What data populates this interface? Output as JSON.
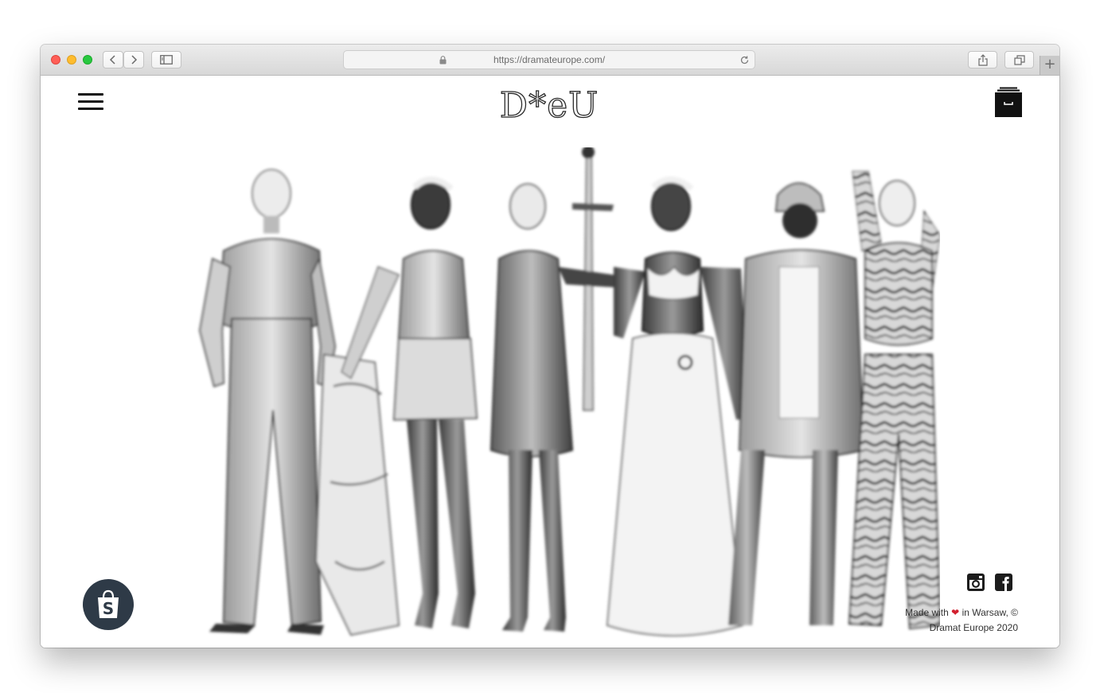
{
  "browser": {
    "url": "https://dramateurope.com/",
    "new_tab_label": "+"
  },
  "header": {
    "logo_text": "D*eU",
    "menu_icon": "hamburger-menu-icon",
    "cart_icon": "shopping-bag-icon"
  },
  "hero": {
    "image": "six-models-fashion-lineup-monochrome"
  },
  "social": {
    "instagram_icon": "instagram-icon",
    "facebook_icon": "facebook-icon"
  },
  "footer": {
    "made_with": "Made with",
    "heart": "❤",
    "in_warsaw": "in Warsaw, ©",
    "copyright": "Dramat Europe 2020"
  },
  "shopify": {
    "icon": "shopify-bag-icon",
    "letter": "S"
  },
  "colors": {
    "close": "#ff5f57",
    "minimize": "#febc2e",
    "zoom": "#28c840",
    "heart": "#d2202f",
    "shopify_bg": "#2e3a47"
  }
}
